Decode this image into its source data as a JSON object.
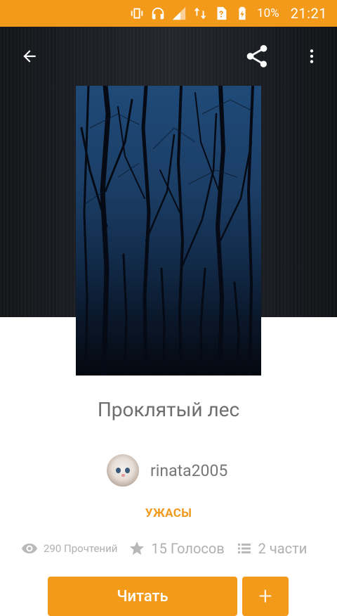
{
  "status_bar": {
    "battery_text": "10%",
    "time": "21:21",
    "color": "#f39a1b"
  },
  "story": {
    "title": "Проклятый лес",
    "author": "rinata2005",
    "genre": "УЖАСЫ",
    "reads": "290 Прочтений",
    "votes": "15 Голосов",
    "parts": "2 части"
  },
  "actions": {
    "read_label": "Читать",
    "add_label": "+"
  },
  "icons": {
    "back": "arrow-back-icon",
    "share": "share-icon",
    "more": "more-vert-icon"
  },
  "accent_color": "#f39a1b"
}
